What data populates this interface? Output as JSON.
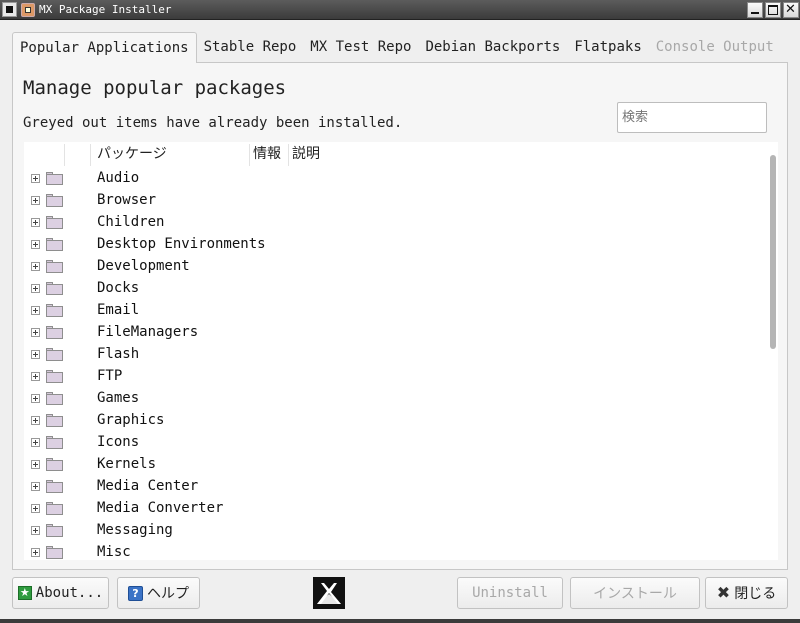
{
  "window": {
    "title": "MX Package Installer"
  },
  "tabs": [
    {
      "label": "Popular Applications",
      "active": true,
      "enabled": true
    },
    {
      "label": "Stable Repo",
      "active": false,
      "enabled": true
    },
    {
      "label": "MX Test Repo",
      "active": false,
      "enabled": true
    },
    {
      "label": "Debian Backports",
      "active": false,
      "enabled": true
    },
    {
      "label": "Flatpaks",
      "active": false,
      "enabled": true
    },
    {
      "label": "Console Output",
      "active": false,
      "enabled": false
    }
  ],
  "pane": {
    "title": "Manage popular packages",
    "subtitle": "Greyed out items have already been installed.",
    "search_placeholder": "検索"
  },
  "tree": {
    "columns": [
      "パッケージ",
      "情報",
      "説明"
    ],
    "items": [
      "Audio",
      "Browser",
      "Children",
      "Desktop Environments",
      "Development",
      "Docks",
      "Email",
      "FileManagers",
      "Flash",
      "FTP",
      "Games",
      "Graphics",
      "Icons",
      "Kernels",
      "Media Center",
      "Media Converter",
      "Messaging",
      "Misc"
    ]
  },
  "buttons": {
    "about": "About...",
    "help": "ヘルプ",
    "uninstall": "Uninstall",
    "install": "インストール",
    "close": "閉じる"
  },
  "icons": {
    "about": "star-icon",
    "help": "question-icon",
    "close": "x-icon",
    "logo": "mx-logo"
  },
  "colors": {
    "titlebar": "#4a4a4a",
    "folder": "#dcd0e2",
    "disabled_text": "#a8a8a8"
  }
}
